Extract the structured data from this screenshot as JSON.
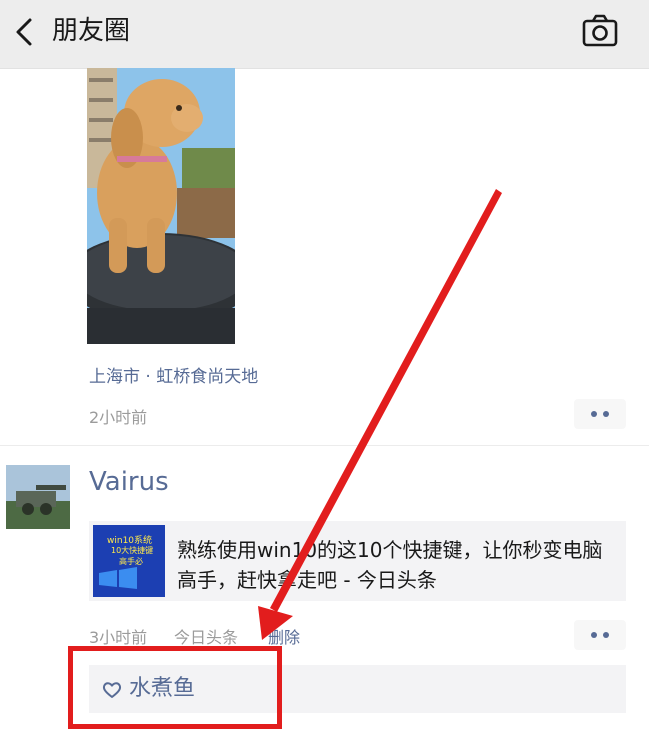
{
  "header": {
    "title": "朋友圈"
  },
  "post1": {
    "location": "上海市 · 虹桥食尚天地",
    "time": "2小时前"
  },
  "post2": {
    "username": "Vairus",
    "share": {
      "text": "熟练使用win10的这10个快捷键，让你秒变电脑高手，赶快拿走吧 - 今日头条",
      "thumb_line1": "win10系统",
      "thumb_line2": "10大快捷键",
      "thumb_line3": "高手必",
      "thumb_color": "#1c3fb2"
    },
    "time": "3小时前",
    "source": "今日头条",
    "delete_label": "删除",
    "likes": [
      "水煮鱼"
    ]
  },
  "annotation": {
    "color": "#e21d1d"
  },
  "colors": {
    "link": "#576b95",
    "header_bg": "#ededed",
    "meta_gray": "#9b9b9b"
  }
}
